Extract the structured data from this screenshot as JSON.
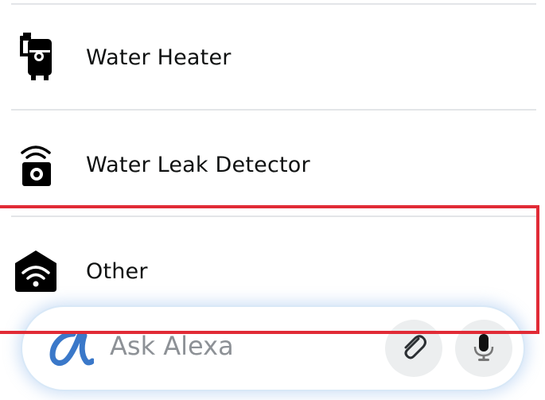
{
  "items": [
    {
      "label": "Water Heater",
      "icon": "water-heater-icon"
    },
    {
      "label": "Water Leak Detector",
      "icon": "water-leak-detector-icon"
    },
    {
      "label": "Other",
      "icon": "smart-home-wifi-icon"
    }
  ],
  "ask_bar": {
    "placeholder": "Ask Alexa",
    "logo": "alexa-logo-icon",
    "attach": "paperclip-icon",
    "voice": "microphone-icon"
  },
  "colors": {
    "highlight": "#e12b36",
    "alexa_blue": "#3a78c9",
    "text": "#0f1111",
    "placeholder": "#8d9196"
  }
}
